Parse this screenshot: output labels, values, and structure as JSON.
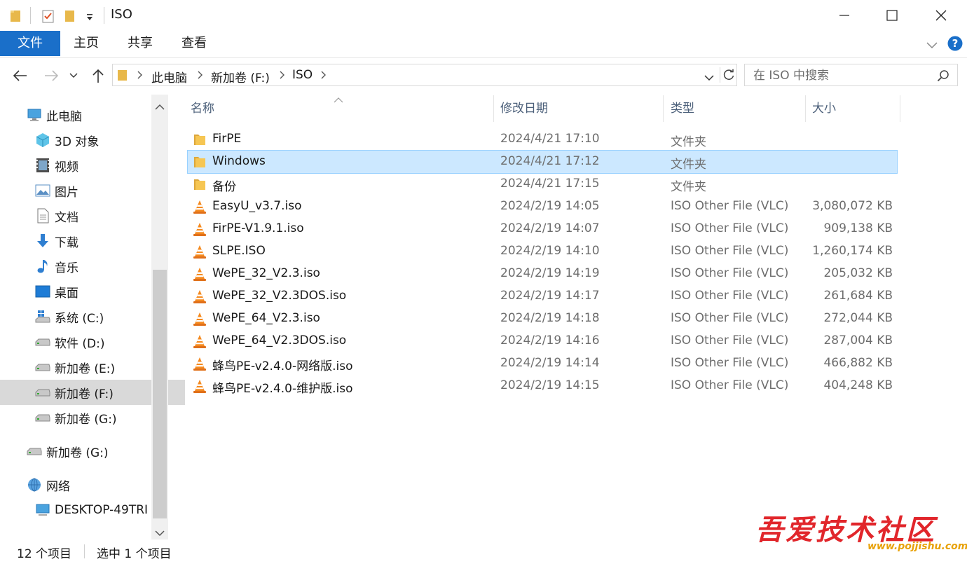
{
  "window": {
    "title": "ISO"
  },
  "ribbon": {
    "tabs": [
      "文件",
      "主页",
      "共享",
      "查看"
    ]
  },
  "address": {
    "segments": [
      "此电脑",
      "新加卷 (F:)",
      "ISO"
    ]
  },
  "search": {
    "placeholder": "在 ISO 中搜索"
  },
  "sidebar": {
    "items": [
      {
        "label": "此电脑",
        "icon": "computer-icon"
      },
      {
        "label": "3D 对象",
        "icon": "cube-3d-icon"
      },
      {
        "label": "视频",
        "icon": "video-icon"
      },
      {
        "label": "图片",
        "icon": "picture-icon"
      },
      {
        "label": "文档",
        "icon": "document-icon"
      },
      {
        "label": "下载",
        "icon": "download-icon"
      },
      {
        "label": "音乐",
        "icon": "music-icon"
      },
      {
        "label": "桌面",
        "icon": "desktop-icon"
      },
      {
        "label": "系统 (C:)",
        "icon": "system-drive-icon"
      },
      {
        "label": "软件 (D:)",
        "icon": "drive-icon"
      },
      {
        "label": "新加卷 (E:)",
        "icon": "drive-icon"
      },
      {
        "label": "新加卷 (F:)",
        "icon": "drive-icon"
      },
      {
        "label": "新加卷 (G:)",
        "icon": "drive-icon"
      },
      {
        "label": "新加卷 (G:)",
        "icon": "drive-icon"
      },
      {
        "label": "网络",
        "icon": "network-icon"
      },
      {
        "label": "DESKTOP-49TRI",
        "icon": "network-computer-icon"
      }
    ]
  },
  "columns": {
    "name": "名称",
    "date": "修改日期",
    "type": "类型",
    "size": "大小"
  },
  "files": [
    {
      "name": "FirPE",
      "date": "2024/4/21 17:10",
      "type": "文件夹",
      "size": "",
      "icon": "folder-icon"
    },
    {
      "name": "Windows",
      "date": "2024/4/21 17:12",
      "type": "文件夹",
      "size": "",
      "icon": "folder-icon"
    },
    {
      "name": "备份",
      "date": "2024/4/21 17:15",
      "type": "文件夹",
      "size": "",
      "icon": "folder-icon"
    },
    {
      "name": "EasyU_v3.7.iso",
      "date": "2024/2/19 14:05",
      "type": "ISO Other File (VLC)",
      "size": "3,080,072 KB",
      "icon": "vlc-cone-icon"
    },
    {
      "name": "FirPE-V1.9.1.iso",
      "date": "2024/2/19 14:07",
      "type": "ISO Other File (VLC)",
      "size": "909,138 KB",
      "icon": "vlc-cone-icon"
    },
    {
      "name": "SLPE.ISO",
      "date": "2024/2/19 14:10",
      "type": "ISO Other File (VLC)",
      "size": "1,260,174 KB",
      "icon": "vlc-cone-icon"
    },
    {
      "name": "WePE_32_V2.3.iso",
      "date": "2024/2/19 14:19",
      "type": "ISO Other File (VLC)",
      "size": "205,032 KB",
      "icon": "vlc-cone-icon"
    },
    {
      "name": "WePE_32_V2.3DOS.iso",
      "date": "2024/2/19 14:17",
      "type": "ISO Other File (VLC)",
      "size": "261,684 KB",
      "icon": "vlc-cone-icon"
    },
    {
      "name": "WePE_64_V2.3.iso",
      "date": "2024/2/19 14:18",
      "type": "ISO Other File (VLC)",
      "size": "272,044 KB",
      "icon": "vlc-cone-icon"
    },
    {
      "name": "WePE_64_V2.3DOS.iso",
      "date": "2024/2/19 14:16",
      "type": "ISO Other File (VLC)",
      "size": "287,004 KB",
      "icon": "vlc-cone-icon"
    },
    {
      "name": "蜂鸟PE-v2.4.0-网络版.iso",
      "date": "2024/2/19 14:14",
      "type": "ISO Other File (VLC)",
      "size": "466,882 KB",
      "icon": "vlc-cone-icon"
    },
    {
      "name": "蜂鸟PE-v2.4.0-维护版.iso",
      "date": "2024/2/19 14:15",
      "type": "ISO Other File (VLC)",
      "size": "404,248 KB",
      "icon": "vlc-cone-icon"
    }
  ],
  "status": {
    "count": "12 个项目",
    "selected": "选中 1 个项目"
  },
  "watermark": {
    "title": "吾爱技术社区",
    "url": "www.pojjishu.com"
  },
  "colors": {
    "accent": "#1a6fc9",
    "selection": "#cce8ff",
    "header_text": "#4c607a"
  }
}
